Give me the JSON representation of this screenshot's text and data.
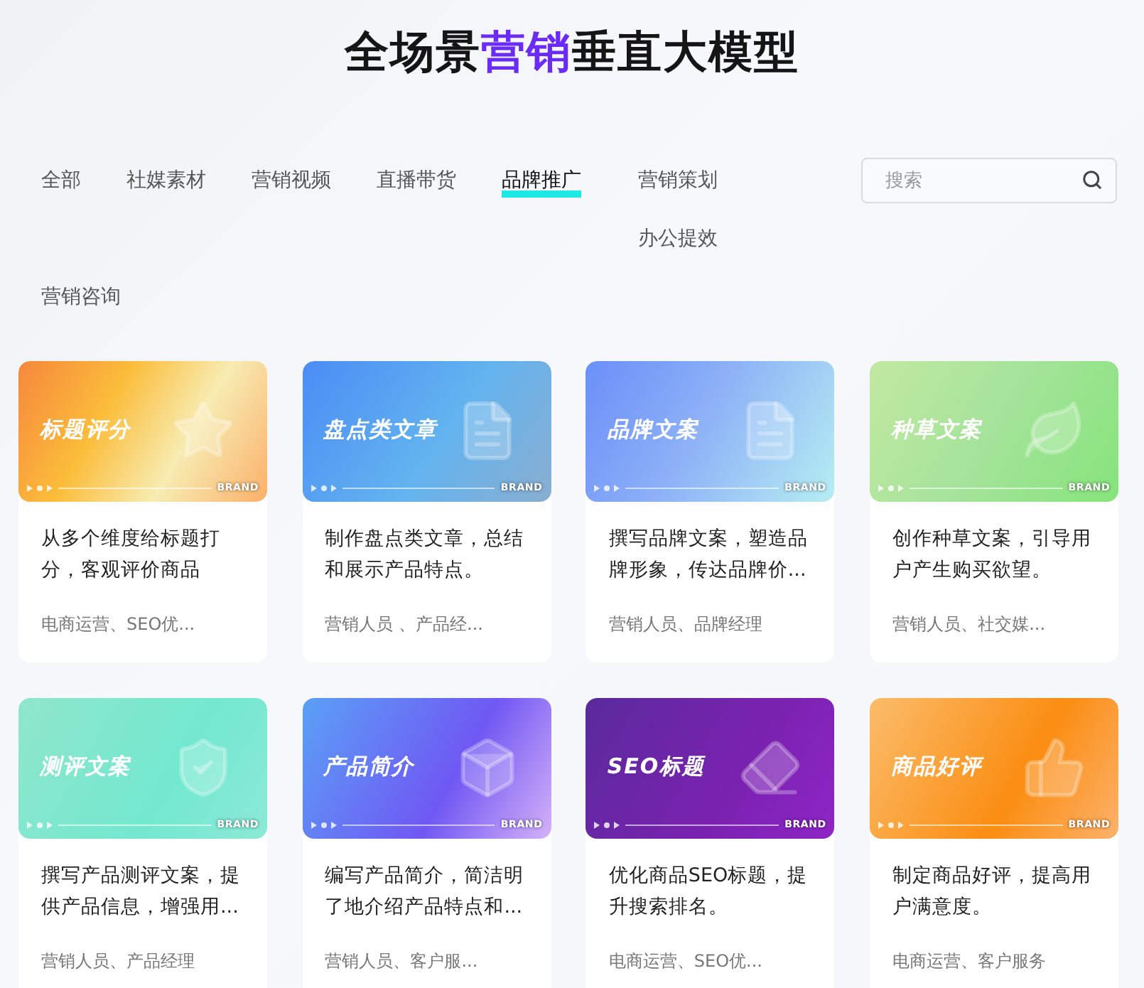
{
  "header": {
    "title_before": "全场景",
    "title_highlight": "营销",
    "title_after": "垂直大模型"
  },
  "tabs": [
    {
      "label": "全部",
      "selected": false
    },
    {
      "label": "社媒素材",
      "selected": false
    },
    {
      "label": "营销视频",
      "selected": false
    },
    {
      "label": "直播带货",
      "selected": false
    },
    {
      "label": "品牌推广",
      "selected": true
    },
    {
      "label": "营销策划",
      "selected": false
    },
    {
      "label": "办公提效",
      "selected": false
    },
    {
      "label": "营销咨询",
      "selected": false
    }
  ],
  "search": {
    "placeholder": "搜索"
  },
  "cards": [
    {
      "banner_title": "标题评分",
      "brand_mark": "BRAND",
      "description": "从多个维度给标题打分，客观评价商品",
      "tags": "电商运营、SEO优..."
    },
    {
      "banner_title": "盘点类文章",
      "brand_mark": "BRAND",
      "description": "制作盘点类文章，总结和展示产品特点。",
      "tags": "营销人员 、产品经..."
    },
    {
      "banner_title": "品牌文案",
      "brand_mark": "BRAND",
      "description": "撰写品牌文案，塑造品牌形象，传达品牌价...",
      "tags": "营销人员、品牌经理"
    },
    {
      "banner_title": "种草文案",
      "brand_mark": "BRAND",
      "description": "创作种草文案，引导用户产生购买欲望。",
      "tags": "营销人员、社交媒..."
    },
    {
      "banner_title": "测评文案",
      "brand_mark": "BRAND",
      "description": "撰写产品测评文案，提供产品信息，增强用...",
      "tags": "营销人员、产品经理"
    },
    {
      "banner_title": "产品简介",
      "brand_mark": "BRAND",
      "description": "编写产品简介，简洁明了地介绍产品特点和...",
      "tags": "营销人员、客户服..."
    },
    {
      "banner_title": "SEO标题",
      "brand_mark": "BRAND",
      "description": "优化商品SEO标题，提升搜索排名。",
      "tags": "电商运营、SEO优..."
    },
    {
      "banner_title": "商品好评",
      "brand_mark": "BRAND",
      "description": "制定商品好评，提高用户满意度。",
      "tags": "电商运营、客户服务"
    }
  ]
}
